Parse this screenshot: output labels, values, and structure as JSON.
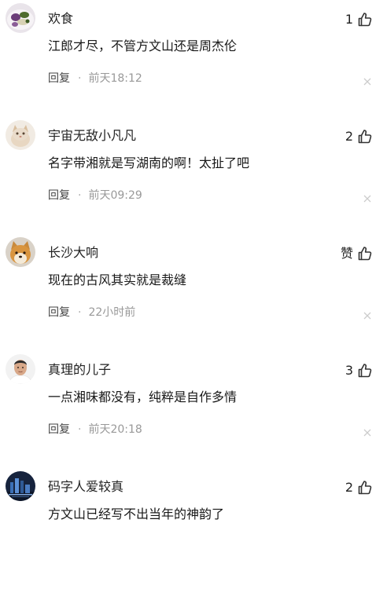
{
  "reply_label": "回复",
  "separator": "·",
  "comments": [
    {
      "username": "欢食",
      "likes": "1",
      "text": "江郎才尽，不管方文山还是周杰伦",
      "time": "前天18:12",
      "avatar": "food-plate-avatar"
    },
    {
      "username": "宇宙无敌小凡凡",
      "likes": "2",
      "text": "名字带湘就是写湖南的啊！太扯了吧",
      "time": "前天09:29",
      "avatar": "cat-avatar"
    },
    {
      "username": "长沙大响",
      "likes": "赞",
      "text": "现在的古风其实就是裁缝",
      "time": "22小时前",
      "avatar": "shiba-dog-avatar"
    },
    {
      "username": "真理的儿子",
      "likes": "3",
      "text": "一点湘味都没有，纯粹是自作多情",
      "time": "前天20:18",
      "avatar": "person-portrait-avatar"
    },
    {
      "username": "码字人爱较真",
      "likes": "2",
      "text": "方文山已经写不出当年的神韵了",
      "time": "",
      "avatar": "city-night-avatar"
    }
  ],
  "colors": {
    "text_primary": "#191919",
    "text_secondary": "#999999",
    "icon": "#333333",
    "close_icon": "#cccccc"
  }
}
